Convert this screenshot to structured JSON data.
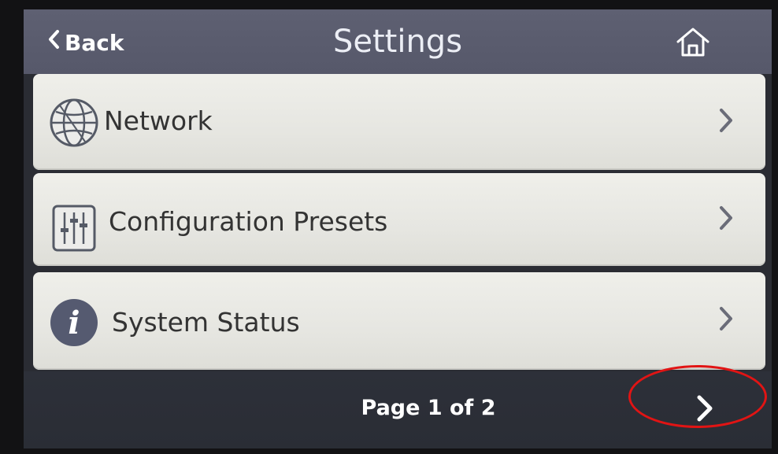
{
  "header": {
    "back_label": "Back",
    "title": "Settings",
    "home_icon": "home-icon"
  },
  "menu": {
    "items": [
      {
        "label": "Network",
        "icon": "globe-icon"
      },
      {
        "label": "Configuration Presets",
        "icon": "sliders-icon"
      },
      {
        "label": "System Status",
        "icon": "info-icon"
      }
    ]
  },
  "footer": {
    "page_label": "Page 1 of 2",
    "next_icon": "chevron-right-icon"
  },
  "annotation": {
    "highlight_color": "#e11414"
  }
}
